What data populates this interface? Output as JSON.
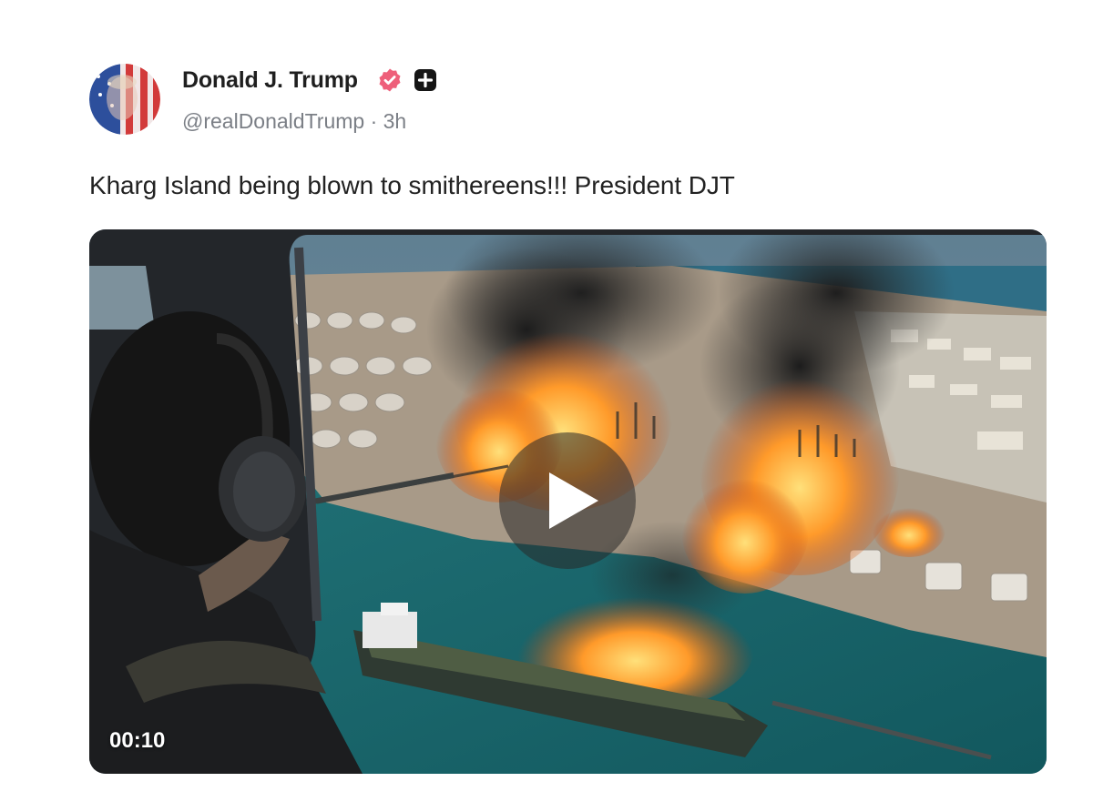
{
  "post": {
    "author": {
      "display_name": "Donald J. Trump",
      "handle": "@realDonaldTrump",
      "separator": "·",
      "time_ago": "3h",
      "verified_icon": "verified-badge-icon",
      "extra_icon": "plus-icon",
      "colors": {
        "verified": "#ee5f7a",
        "name": "#1f1f1f",
        "meta": "#7b7f86"
      }
    },
    "text": "Kharg Island being blown to smithereens!!! President DJT",
    "media": {
      "type": "video",
      "duration": "00:10",
      "play_icon": "play-icon"
    }
  }
}
